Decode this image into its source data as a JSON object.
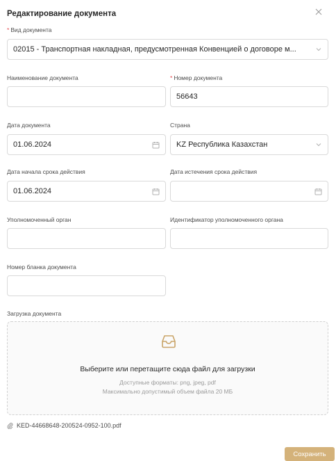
{
  "modal": {
    "title": "Редактирование документа"
  },
  "form": {
    "doc_type": {
      "label": "Вид документа",
      "required": "*",
      "value": "02015 - Транспортная накладная, предусмотренная Конвенцией о договоре м..."
    },
    "doc_name": {
      "label": "Наименование документа",
      "value": ""
    },
    "doc_number": {
      "label": "Номер документа",
      "required": "*",
      "value": "56643"
    },
    "doc_date": {
      "label": "Дата документа",
      "value": "01.06.2024"
    },
    "country": {
      "label": "Страна",
      "value": "KZ Республика Казахстан"
    },
    "valid_from": {
      "label": "Дата начала срока действия",
      "value": "01.06.2024"
    },
    "valid_to": {
      "label": "Дата истечения срока действия",
      "value": ""
    },
    "authority": {
      "label": "Уполномоченный орган",
      "value": ""
    },
    "authority_id": {
      "label": "Идентификатор уполномоченного органа",
      "value": ""
    },
    "blank_number": {
      "label": "Номер бланка документа",
      "value": ""
    }
  },
  "upload": {
    "label": "Загрузка документа",
    "title": "Выберите или перетащите сюда файл для загрузки",
    "formats": "Доступные форматы: png, jpeg, pdf",
    "max_size": "Максимально допустимый объем файла 20 МБ",
    "icon": "inbox-icon"
  },
  "attachment": {
    "file_name": "KED-44668648-200524-0952-100.pdf",
    "icon": "paperclip-icon"
  },
  "actions": {
    "save_label": "Сохранить"
  },
  "colors": {
    "accent": "#d4b27a",
    "required": "#e5484d",
    "border": "#d9d9d9"
  }
}
